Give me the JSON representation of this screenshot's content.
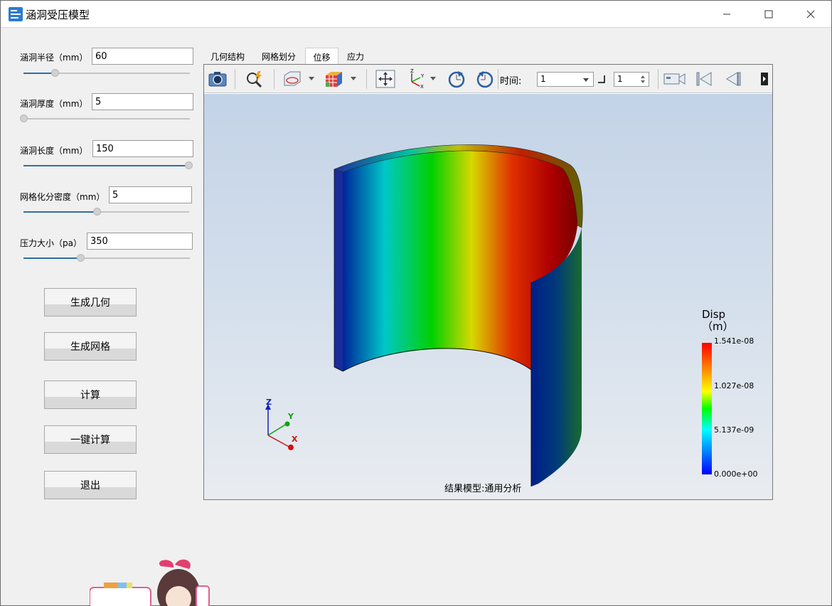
{
  "window": {
    "title": "涵洞受压模型"
  },
  "params": [
    {
      "label": "涵洞半径（mm）",
      "value": "60",
      "level": 0.19
    },
    {
      "label": "涵洞厚度（mm）",
      "value": "5",
      "level": 0.0
    },
    {
      "label": "涵洞长度（mm）",
      "value": "150",
      "level": 1.0
    },
    {
      "label": "网格化分密度（mm）",
      "value": "5",
      "level": 0.44
    },
    {
      "label": "压力大小（pa）",
      "value": "350",
      "level": 0.34
    }
  ],
  "buttons": {
    "generate_geometry": "生成几何",
    "generate_mesh": "生成网格",
    "compute": "计算",
    "one_click_compute": "一键计算",
    "exit": "退出"
  },
  "tabs": [
    {
      "label": "几何结构",
      "active": false
    },
    {
      "label": "网格划分",
      "active": false
    },
    {
      "label": "位移",
      "active": true
    },
    {
      "label": "应力",
      "active": false
    }
  ],
  "toolbar": {
    "time_label": "时间:",
    "time_value": "1",
    "step_value": "1"
  },
  "viewer": {
    "axes": {
      "x": "X",
      "y": "Y",
      "z": "Z"
    },
    "legend": {
      "title_line1": "Disp",
      "title_line2": "（m）",
      "values": [
        "1.541e-08",
        "1.027e-08",
        "5.137e-09",
        "0.000e+00"
      ]
    },
    "result_caption": "结果模型:通用分析"
  },
  "colors": {
    "accent": "#2f6ea8",
    "legend_max": "#ff0000",
    "legend_min": "#0000ff"
  }
}
